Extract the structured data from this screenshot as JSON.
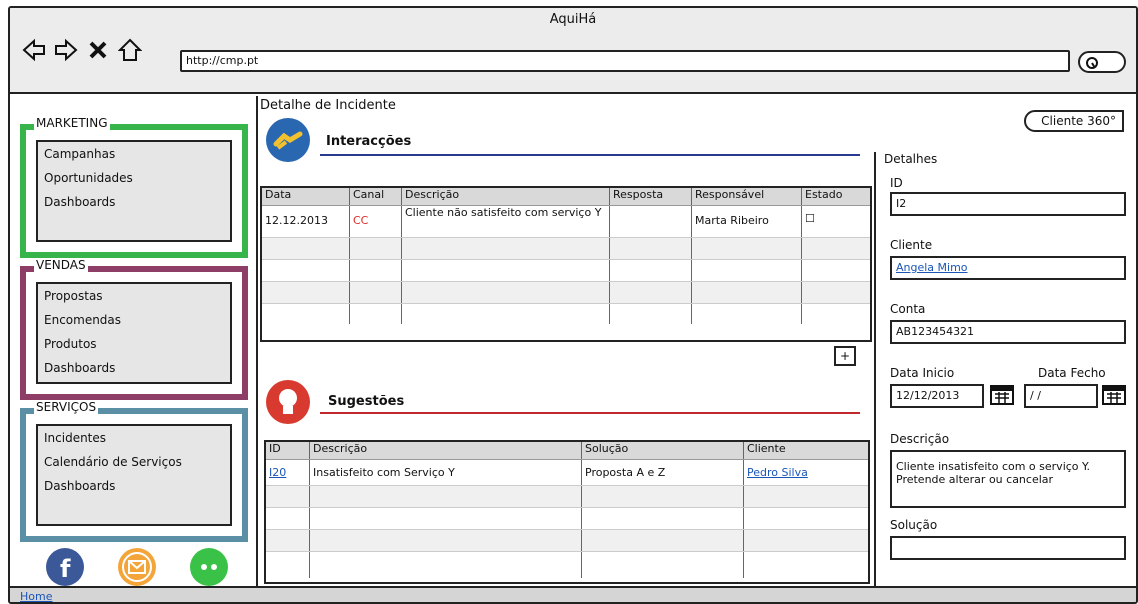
{
  "window": {
    "title": "AquiHá",
    "url": "http://cmp.pt"
  },
  "sidebar": {
    "groups": [
      {
        "label": "MARKETING",
        "items": [
          "Campanhas",
          "Oportunidades",
          "Dashboards"
        ]
      },
      {
        "label": "VENDAS",
        "items": [
          "Propostas",
          "Encomendas",
          "Produtos",
          "Dashboards"
        ]
      },
      {
        "label": "SERVIÇOS",
        "items": [
          "Incidentes",
          "Calendário de Serviços",
          "Dashboards"
        ]
      }
    ],
    "social_icons": [
      "facebook-icon",
      "mail-icon",
      "chat-icon"
    ]
  },
  "main": {
    "title": "Detalhe de Incidente",
    "cliente360": "Cliente 360°",
    "interaccoes": {
      "title": "Interacções",
      "columns": [
        "Data",
        "Canal",
        "Descrição",
        "Resposta",
        "Responsável",
        "Estado"
      ],
      "rows": [
        [
          "12.12.2013",
          "CC",
          "Cliente não satisfeito com serviço Y",
          "",
          "Marta Ribeiro",
          "☐"
        ]
      ]
    },
    "plus_label": "+",
    "sugestoes": {
      "title": "Sugestões",
      "columns": [
        "ID",
        "Descrição",
        "Solução",
        "Cliente"
      ],
      "rows": [
        [
          "I20",
          "Insatisfeito com Serviço Y",
          "Proposta A e Z",
          "Pedro Silva"
        ]
      ]
    }
  },
  "details": {
    "header": "Detalhes",
    "id_label": "ID",
    "id_value": "I2",
    "cliente_label": "Cliente",
    "cliente_value": "Angela Mimo",
    "conta_label": "Conta",
    "conta_value": "AB123454321",
    "data_inicio_label": "Data Inicio",
    "data_inicio_value": "12/12/2013",
    "data_fecho_label": "Data Fecho",
    "data_fecho_value": " / /",
    "descricao_label": "Descrição",
    "descricao_value": "Cliente insatisfeito com o serviço Y. Pretende alterar ou cancelar",
    "solucao_label": "Solução",
    "solucao_value": ""
  },
  "statusbar": {
    "link": "Home"
  },
  "colors": {
    "marketing": "#37b54b",
    "vendas": "#8e3d67",
    "servicos": "#5a8fa6",
    "interaccoes_line": "#2a3b8f",
    "sugestoes_line": "#c0282d"
  }
}
